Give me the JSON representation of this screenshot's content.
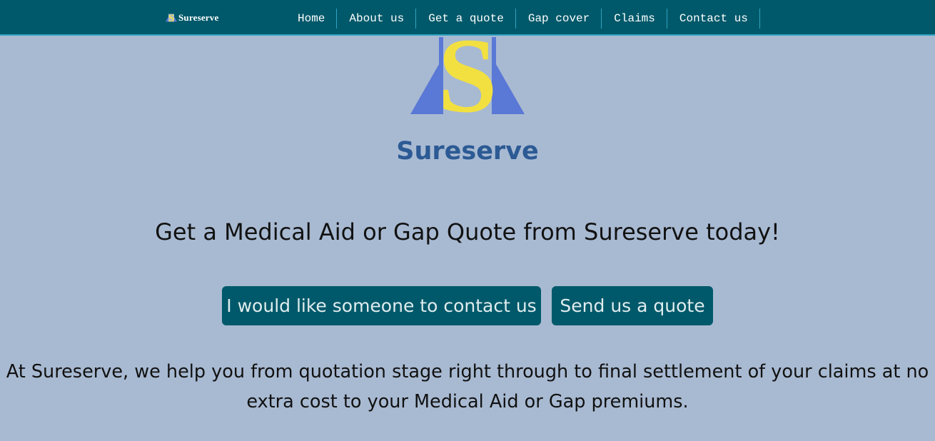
{
  "nav": {
    "brand": "Sureserve",
    "links": [
      {
        "label": "Home"
      },
      {
        "label": "About us"
      },
      {
        "label": "Get a quote"
      },
      {
        "label": "Gap cover"
      },
      {
        "label": "Claims"
      },
      {
        "label": "Contact us"
      }
    ]
  },
  "hero": {
    "logo_icon": "sureserve-logo",
    "site_name": "Sureserve",
    "tagline": "Get a Medical Aid or Gap Quote from Sureserve today!",
    "buttons": {
      "contact_label": "I would like someone to contact us",
      "quote_label": "Send us a quote"
    },
    "description": "At Sureserve, we help you from quotation stage right through to final settlement of your claims at no extra cost to your Medical Aid or Gap premiums."
  },
  "colors": {
    "navbar": "#00596a",
    "nav_divider": "#2fa3c0",
    "page_background": "#a8bad2",
    "site_name": "#2c5a94",
    "logo_blue": "#5a78d6",
    "logo_yellow": "#f2e040",
    "button_bg": "#00596a"
  }
}
